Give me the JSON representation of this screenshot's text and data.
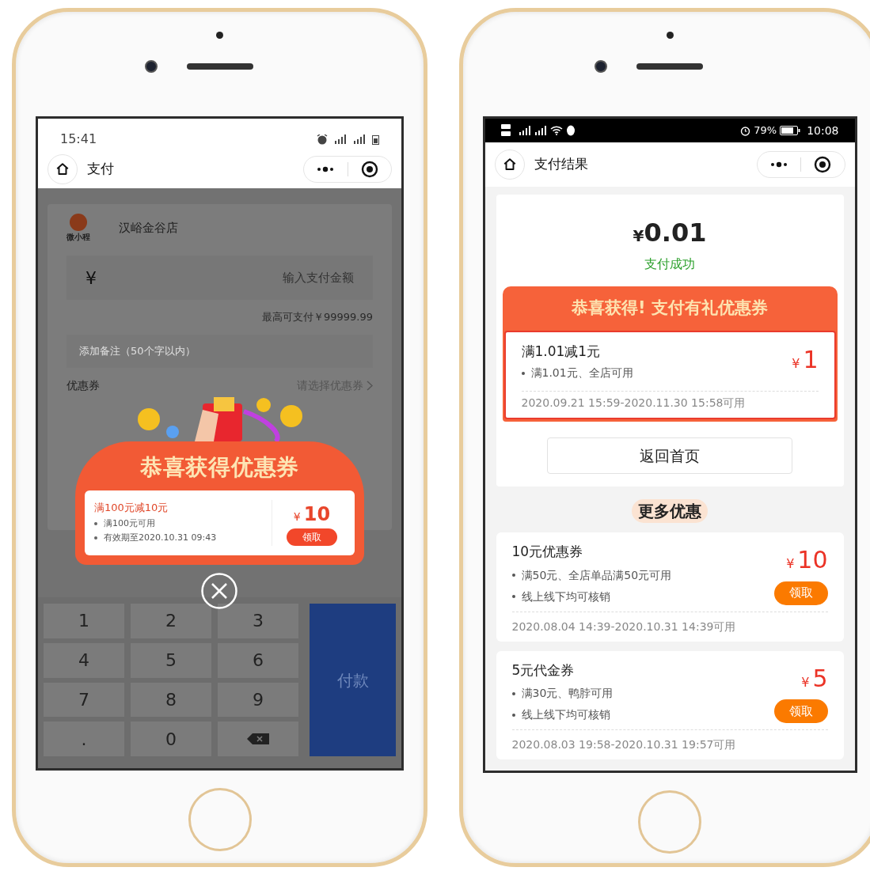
{
  "left_phone": {
    "status_bar": {
      "time": "15:41"
    },
    "nav": {
      "title": "支付"
    },
    "store": {
      "logo_text": "微小程",
      "name": "汉峪金谷店"
    },
    "amount_field": {
      "currency": "¥",
      "placeholder": "输入支付金额"
    },
    "max_hint": "最高可支付￥99999.99",
    "remark_field": {
      "placeholder": "添加备注（50个字以内）"
    },
    "coupon_row": {
      "label": "优惠券",
      "action": "请选择优惠券"
    },
    "popup": {
      "title": "恭喜获得优惠券",
      "coupon": {
        "name": "满100元减10元",
        "conditions": [
          "满100元可用",
          "有效期至2020.10.31 09:43"
        ],
        "currency": "¥",
        "value": "10",
        "button": "领取"
      }
    },
    "keypad": {
      "keys": [
        "1",
        "2",
        "3",
        "4",
        "5",
        "6",
        "7",
        "8",
        "9",
        ".",
        "0"
      ],
      "pay_button": "付款"
    }
  },
  "right_phone": {
    "status_bar": {
      "battery": "79%",
      "time": "10:08"
    },
    "nav": {
      "title": "支付结果"
    },
    "amount": {
      "currency": "¥",
      "value": "0.01"
    },
    "status": "支付成功",
    "gift_banner": {
      "title": "恭喜获得! 支付有礼优惠券",
      "coupon": {
        "name": "满1.01减1元",
        "conditions": [
          "满1.01元、全店可用"
        ],
        "currency": "¥",
        "value": "1",
        "validity": "2020.09.21 15:59-2020.11.30 15:58可用"
      }
    },
    "home_button": "返回首页",
    "more_title": "更多优惠",
    "coupons": [
      {
        "name": "10元优惠券",
        "conditions": [
          "满50元、全店单品满50元可用",
          "线上线下均可核销"
        ],
        "currency": "¥",
        "value": "10",
        "button": "领取",
        "validity": "2020.08.04 14:39-2020.10.31 14:39可用"
      },
      {
        "name": "5元代金券",
        "conditions": [
          "满30元、鸭脖可用",
          "线上线下均可核销"
        ],
        "currency": "¥",
        "value": "5",
        "button": "领取",
        "validity": "2020.08.03 19:58-2020.10.31 19:57可用"
      }
    ]
  }
}
